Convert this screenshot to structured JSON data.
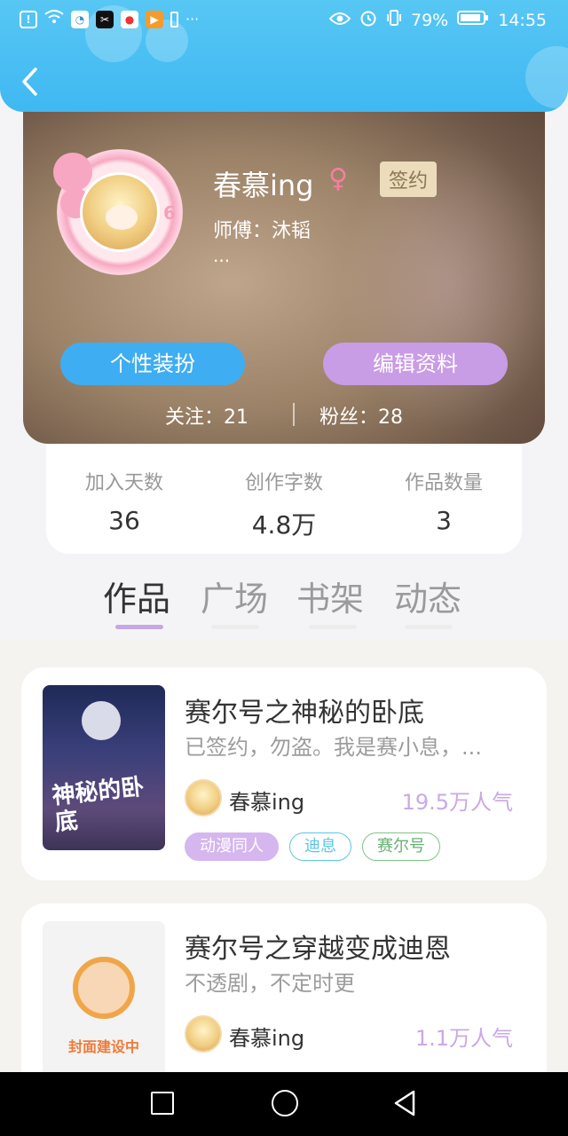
{
  "status_bar": {
    "battery_percent": "79%",
    "time": "14:55",
    "more": "···"
  },
  "profile": {
    "username": "春慕ing",
    "gender_symbol": "♀",
    "signed_badge": "签约",
    "level": "6",
    "master": "师傅：沐韬",
    "ellipsis": "...",
    "dress_button": "个性装扮",
    "edit_button": "编辑资料",
    "following": "关注：21",
    "fans": "粉丝：28"
  },
  "stats": [
    {
      "label": "加入天数",
      "value": "36"
    },
    {
      "label": "创作字数",
      "value": "4.8万"
    },
    {
      "label": "作品数量",
      "value": "3"
    }
  ],
  "tabs": [
    {
      "label": "作品",
      "active": true
    },
    {
      "label": "广场",
      "active": false
    },
    {
      "label": "书架",
      "active": false
    },
    {
      "label": "动态",
      "active": false
    }
  ],
  "books": [
    {
      "title": "赛尔号之神秘的卧底",
      "description": "已签约，勿盗。我是赛小息，...",
      "author": "春慕ing",
      "popularity": "19.5万人气",
      "cover_text": "神秘的卧底",
      "tags": [
        "动漫同人",
        "迪息",
        "赛尔号"
      ]
    },
    {
      "title": "赛尔号之穿越变成迪恩",
      "description": "不透剧，不定时更",
      "author": "春慕ing",
      "popularity": "1.1万人气",
      "cover_text": "封面建设中",
      "tags": []
    }
  ],
  "colors": {
    "header": "#3fb8f2",
    "dress_button": "#3fadf2",
    "edit_button": "#c99ce6",
    "accent_purple": "#c9a9e8"
  }
}
